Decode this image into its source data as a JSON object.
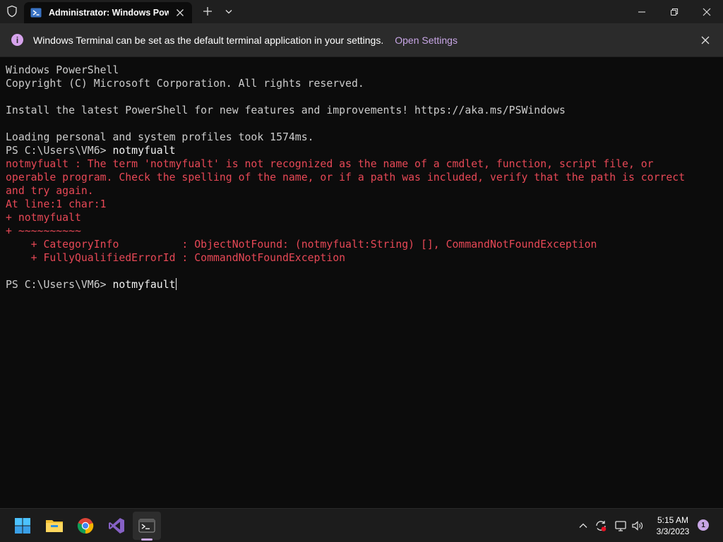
{
  "titlebar": {
    "tab_title": "Administrator: Windows PowerShell"
  },
  "infobar": {
    "message": "Windows Terminal can be set as the default terminal application in your settings.",
    "link": "Open Settings"
  },
  "terminal": {
    "lines": [
      {
        "text": "Windows PowerShell",
        "type": "normal"
      },
      {
        "text": "Copyright (C) Microsoft Corporation. All rights reserved.",
        "type": "normal"
      },
      {
        "text": "",
        "type": "normal"
      },
      {
        "text": "Install the latest PowerShell for new features and improvements! https://aka.ms/PSWindows",
        "type": "normal"
      },
      {
        "text": "",
        "type": "normal"
      },
      {
        "text": "Loading personal and system profiles took 1574ms.",
        "type": "normal"
      },
      {
        "text": "PS C:\\Users\\VM6> ",
        "cmd": "notmyfualt",
        "type": "prompt"
      },
      {
        "text": "notmyfualt : The term 'notmyfualt' is not recognized as the name of a cmdlet, function, script file, or",
        "type": "error"
      },
      {
        "text": "operable program. Check the spelling of the name, or if a path was included, verify that the path is correct",
        "type": "error"
      },
      {
        "text": "and try again.",
        "type": "error"
      },
      {
        "text": "At line:1 char:1",
        "type": "error"
      },
      {
        "text": "+ notmyfualt",
        "type": "error"
      },
      {
        "text": "+ ~~~~~~~~~~",
        "type": "error"
      },
      {
        "text": "    + CategoryInfo          : ObjectNotFound: (notmyfualt:String) [], CommandNotFoundException",
        "type": "error"
      },
      {
        "text": "    + FullyQualifiedErrorId : CommandNotFoundException",
        "type": "error"
      },
      {
        "text": "",
        "type": "normal"
      },
      {
        "text": "PS C:\\Users\\VM6> ",
        "cmd": "notmyfault",
        "type": "prompt-current"
      }
    ]
  },
  "taskbar": {
    "apps": [
      "start-icon",
      "file-explorer-icon",
      "chrome-icon",
      "visual-studio-icon",
      "terminal-icon"
    ],
    "time": "5:15 AM",
    "date": "3/3/2023",
    "notification_count": "1"
  },
  "colors": {
    "background": "#0c0c0c",
    "text": "#cccccc",
    "error": "#e74856",
    "accent": "#c8a6e6"
  }
}
